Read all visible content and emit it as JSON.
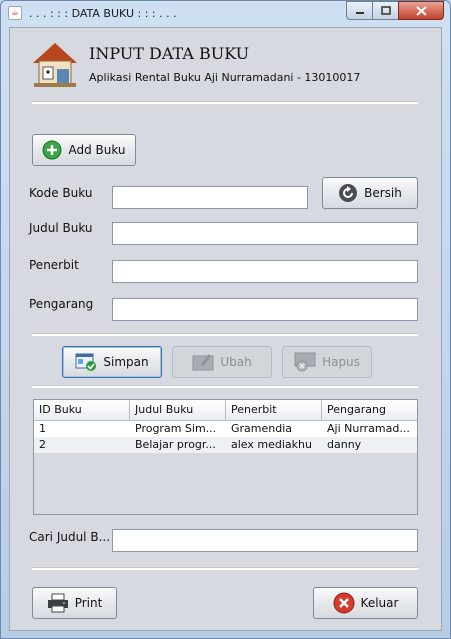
{
  "window": {
    "title": ". . . : : : DATA BUKU : : : . . ."
  },
  "header": {
    "title": "INPUT DATA BUKU",
    "subtitle": "Aplikasi Rental Buku Aji Nurramadani - 13010017"
  },
  "buttons": {
    "add": "Add Buku",
    "bersih": "Bersih",
    "simpan": "Simpan",
    "ubah": "Ubah",
    "hapus": "Hapus",
    "print": "Print",
    "keluar": "Keluar"
  },
  "form": {
    "kode_label": "Kode Buku",
    "judul_label": "Judul Buku",
    "penerbit_label": "Penerbit",
    "pengarang_label": "Pengarang",
    "cari_label": "Cari Judul B..."
  },
  "table": {
    "headers": [
      "ID Buku",
      "Judul Buku",
      "Penerbit",
      "Pengarang"
    ],
    "rows": [
      [
        "1",
        "Program Sim...",
        "Gramendia",
        "Aji Nurramad..."
      ],
      [
        "2",
        "Belajar progr...",
        "alex mediakhu",
        "danny"
      ]
    ]
  },
  "colors": {
    "accent": "#3b6ea5",
    "close": "#c2412c",
    "panel": "#d6d9df"
  },
  "icons": [
    "java-icon",
    "logo-house-icon",
    "add-icon",
    "refresh-icon",
    "save-icon",
    "edit-icon",
    "delete-icon",
    "printer-icon",
    "close-icon"
  ]
}
